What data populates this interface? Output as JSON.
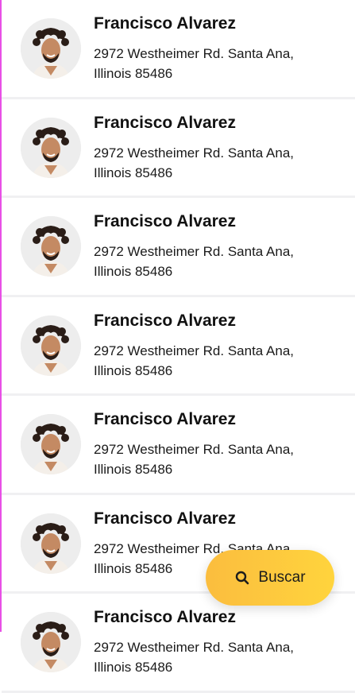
{
  "contacts": [
    {
      "name": "Francisco Alvarez",
      "address_line1": "2972 Westheimer Rd. Santa Ana,",
      "address_line2": "Illinois 85486"
    },
    {
      "name": "Francisco Alvarez",
      "address_line1": "2972 Westheimer Rd. Santa Ana,",
      "address_line2": "Illinois 85486"
    },
    {
      "name": "Francisco Alvarez",
      "address_line1": "2972 Westheimer Rd. Santa Ana,",
      "address_line2": "Illinois 85486"
    },
    {
      "name": "Francisco Alvarez",
      "address_line1": "2972 Westheimer Rd. Santa Ana,",
      "address_line2": "Illinois 85486"
    },
    {
      "name": "Francisco Alvarez",
      "address_line1": "2972 Westheimer Rd. Santa Ana,",
      "address_line2": "Illinois 85486"
    },
    {
      "name": "Francisco Alvarez",
      "address_line1": "2972 Westheimer Rd. Santa Ana,",
      "address_line2": "Illinois 85486"
    },
    {
      "name": "Francisco Alvarez",
      "address_line1": "2972 Westheimer Rd. Santa Ana,",
      "address_line2": "Illinois 85486"
    }
  ],
  "search_button": {
    "label": "Buscar",
    "icon": "search-icon"
  },
  "colors": {
    "fab_gradient_start": "#fbbd3e",
    "fab_gradient_end": "#ffd43d",
    "divider": "#f0f0f2",
    "left_edge": "#e84fe6"
  }
}
